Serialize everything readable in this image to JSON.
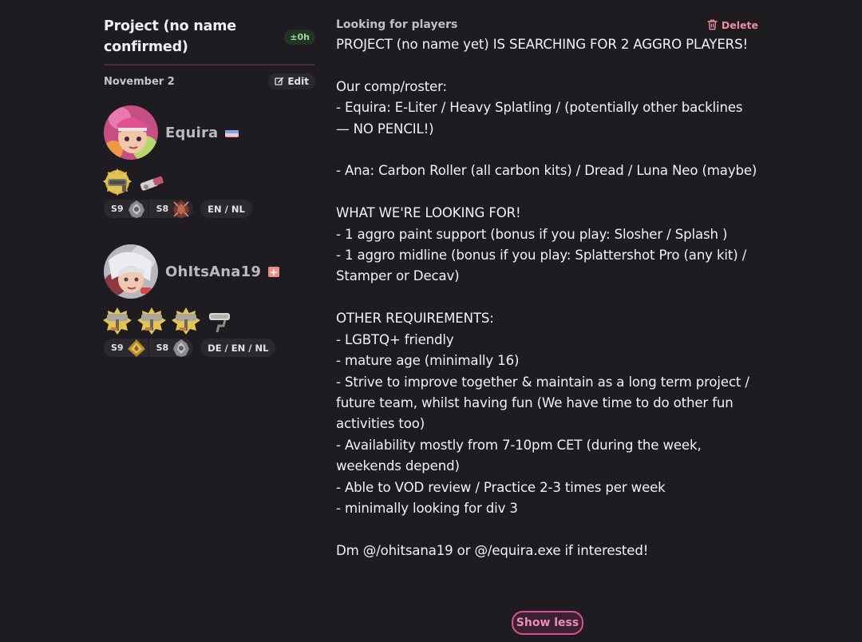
{
  "team": {
    "title": "Project (no name confirmed)",
    "time_badge": "±0h",
    "date": "November 2",
    "edit_label": "Edit"
  },
  "members": [
    {
      "name": "Equira",
      "flag": "blue-pink-flag",
      "weapons": [
        "splatling-badge-icon",
        "hydra-splatling-icon"
      ],
      "seasons": [
        {
          "label": "S9",
          "rank_icon": "silver-rank-icon"
        },
        {
          "label": "S8",
          "rank_icon": "bronze-rank-icon"
        }
      ],
      "languages": "EN / NL"
    },
    {
      "name": "OhItsAna19",
      "flag": "pink-flag",
      "weapons": [
        "roller-badge-icon",
        "roller-badge-icon",
        "roller-badge-icon",
        "carbon-roller-icon"
      ],
      "seasons": [
        {
          "label": "S9",
          "rank_icon": "gold-rank-icon"
        },
        {
          "label": "S8",
          "rank_icon": "silver-rank-icon"
        }
      ],
      "languages": "DE / EN / NL"
    }
  ],
  "post": {
    "label": "Looking for players",
    "delete_label": "Delete",
    "text": "PROJECT (no name yet) IS SEARCHING FOR 2 AGGRO PLAYERS!\n\nOur comp/roster:\n- Equira: E-Liter / Heavy Splatling / (potentially other backlines — NO PENCIL!)\n\n- Ana: Carbon Roller (all carbon kits) / Dread / Luna Neo (maybe)\n\nWHAT WE'RE LOOKING FOR!\n- 1 aggro paint support (bonus if you play: Slosher / Splash )\n- 1 aggro midline (bonus if you play: Splattershot Pro (any kit) / Stamper or Decav)\n\nOTHER REQUIREMENTS:\n- LGBTQ+ friendly\n- mature age (minimally 16)\n- Strive to improve together & maintain as a long term project / future team, whilst having fun (We have time to do other fun activities too)\n- Availability mostly from 7-10pm CET (during the week, weekends depend)\n- Able to VOD review / Practice 2-3 times per week\n- minimally looking for div 3\n\nDm @/ohitsana19 or @/equira.exe if interested!",
    "show_less_label": "Show less"
  },
  "colors": {
    "background": "#1e1b21",
    "accent_pink": "#d65292",
    "delete_red": "#ec8e9d",
    "badge_green": "#9fd6a4"
  }
}
